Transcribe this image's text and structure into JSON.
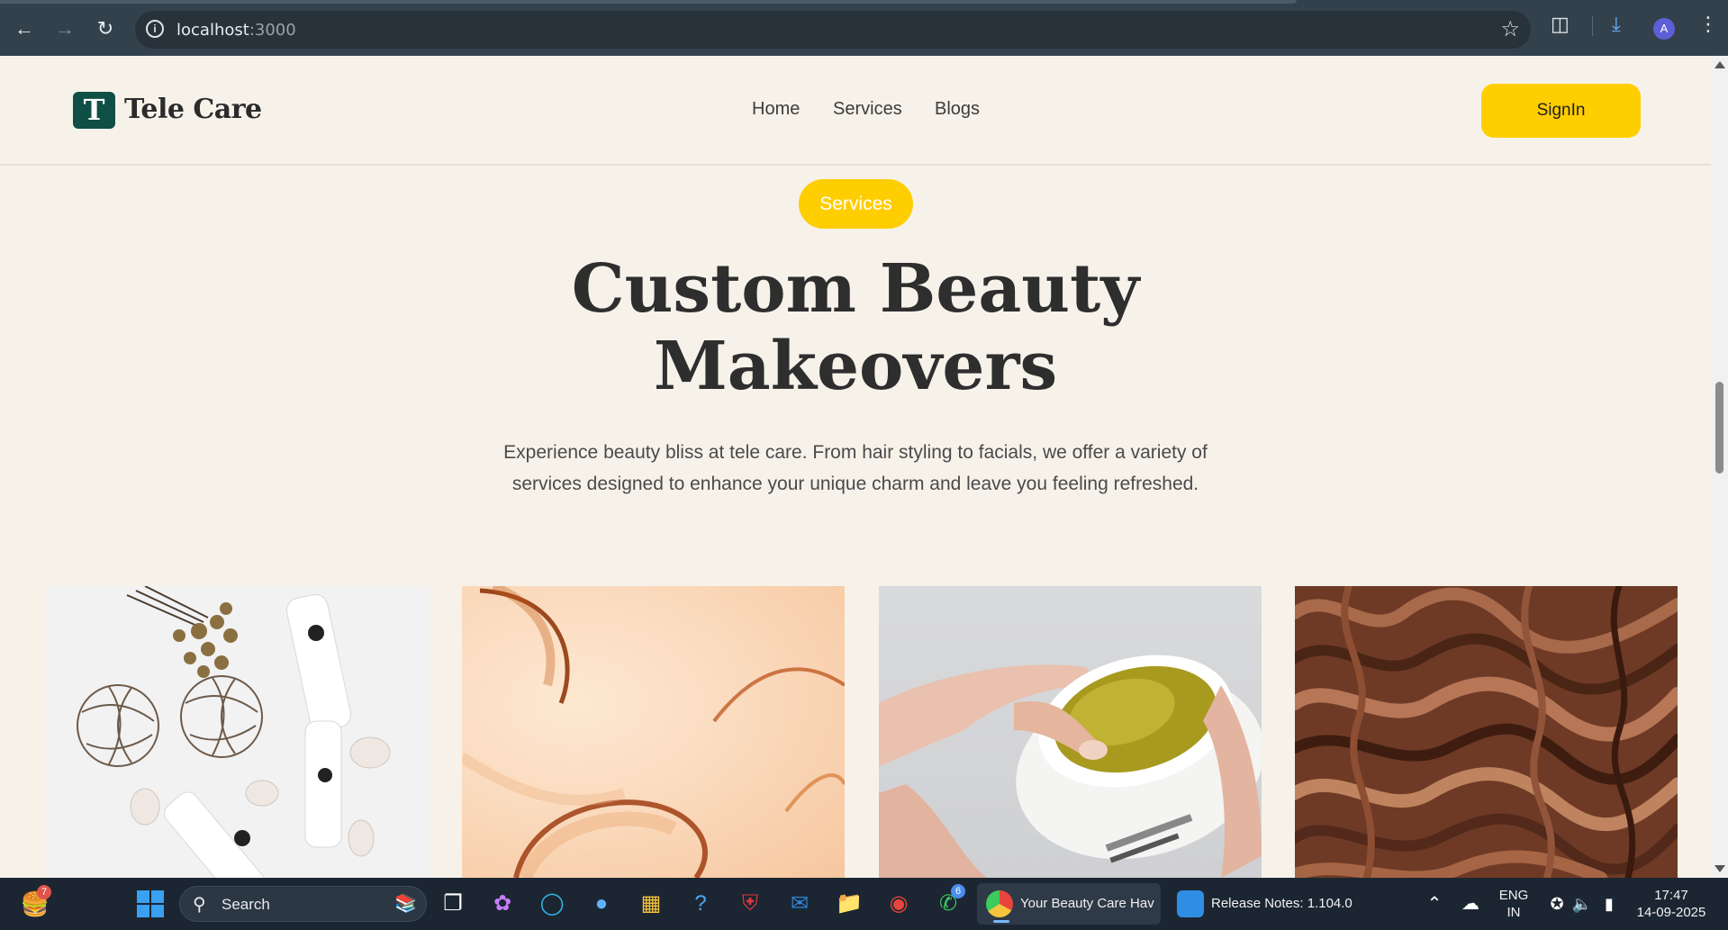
{
  "browser": {
    "url_host": "localhost",
    "url_port": ":3000"
  },
  "site": {
    "logo_letter": "T",
    "logo_text": "Tele Care",
    "nav": [
      "Home",
      "Services",
      "Blogs"
    ],
    "signin_label": "SignIn"
  },
  "hero": {
    "pill": "Services",
    "title_line1": "Custom Beauty",
    "title_line2": "Makeovers",
    "description": "Experience beauty bliss at tele care. From hair styling to facials, we offer a variety of services designed to enhance your unique charm and leave you feeling refreshed."
  },
  "taskbar": {
    "search_label": "Search",
    "widgets_badge": "7",
    "whatsapp_badge": "6",
    "chrome_window_label": "Your Beauty Care Hav",
    "vscode_window_label": "Release Notes: 1.104.0",
    "lang_line1": "ENG",
    "lang_line2": "IN",
    "time": "17:47",
    "date": "14-09-2025"
  },
  "colors": {
    "page_bg": "#f6f2ea",
    "accent_yellow": "#ffce00",
    "logo_green": "#0f4f45",
    "chrome_bg": "#33414d",
    "taskbar_bg": "#1c2632"
  }
}
